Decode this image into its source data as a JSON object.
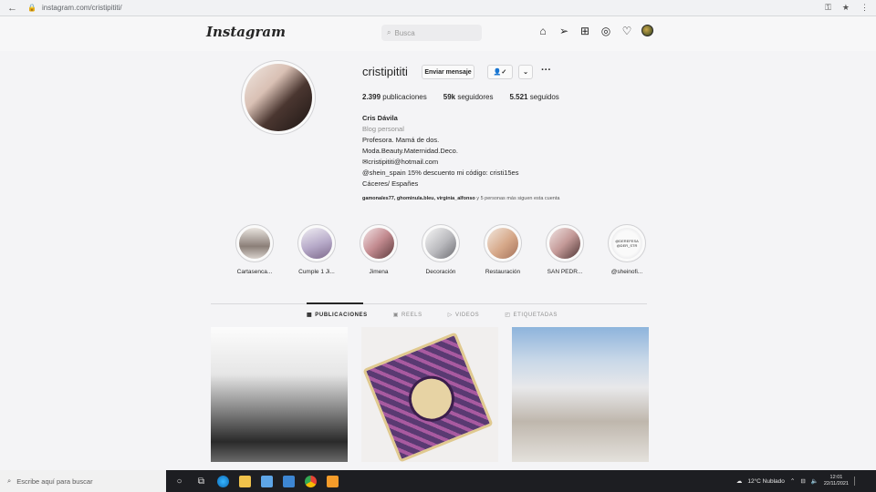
{
  "browser": {
    "url": "instagram.com/cristipititi/"
  },
  "nav": {
    "logo": "Instagram",
    "search_placeholder": "Busca"
  },
  "profile": {
    "username": "cristipititi",
    "message_button": "Enviar mensaje",
    "follow_button": "✓",
    "stats": {
      "posts_count": "2.399",
      "posts_label": "publicaciones",
      "followers_count": "59k",
      "followers_label": "seguidores",
      "following_count": "5.521",
      "following_label": "seguidos"
    },
    "bio": {
      "name": "Cris Dávila",
      "category": "Blog personal",
      "line1": "Profesora. Mamá de dos.",
      "line2": "Moda.Beauty.Maternidad.Deco.",
      "line3": "cristipititi@hotmail.com",
      "line4": "@shein_spain 15% descuento mi código: cristi15es",
      "line5": "Cáceres/ Españes"
    },
    "followed_by_names": "gamonales77, ghominula.bleu, virginia_alfonso",
    "followed_by_suffix": " y 5 personas más siguen esta cuenta"
  },
  "highlights": [
    {
      "label": "Cartasenca..."
    },
    {
      "label": "Cumple 1 Ji..."
    },
    {
      "label": "Jimena"
    },
    {
      "label": "Decoración"
    },
    {
      "label": "Restauración"
    },
    {
      "label": "SAN PEDR..."
    },
    {
      "label": "@sheinofi..."
    }
  ],
  "highlight_6_thumb_text": "@DEREFESA @DER_STR",
  "tabs": [
    {
      "label": "PUBLICACIONES"
    },
    {
      "label": "REELS"
    },
    {
      "label": "VIDEOS"
    },
    {
      "label": "ETIQUETADAS"
    }
  ],
  "taskbar": {
    "search_placeholder": "Escribe aquí para buscar",
    "weather": "12°C Nublado",
    "time": "12:01",
    "date": "22/11/2021"
  }
}
